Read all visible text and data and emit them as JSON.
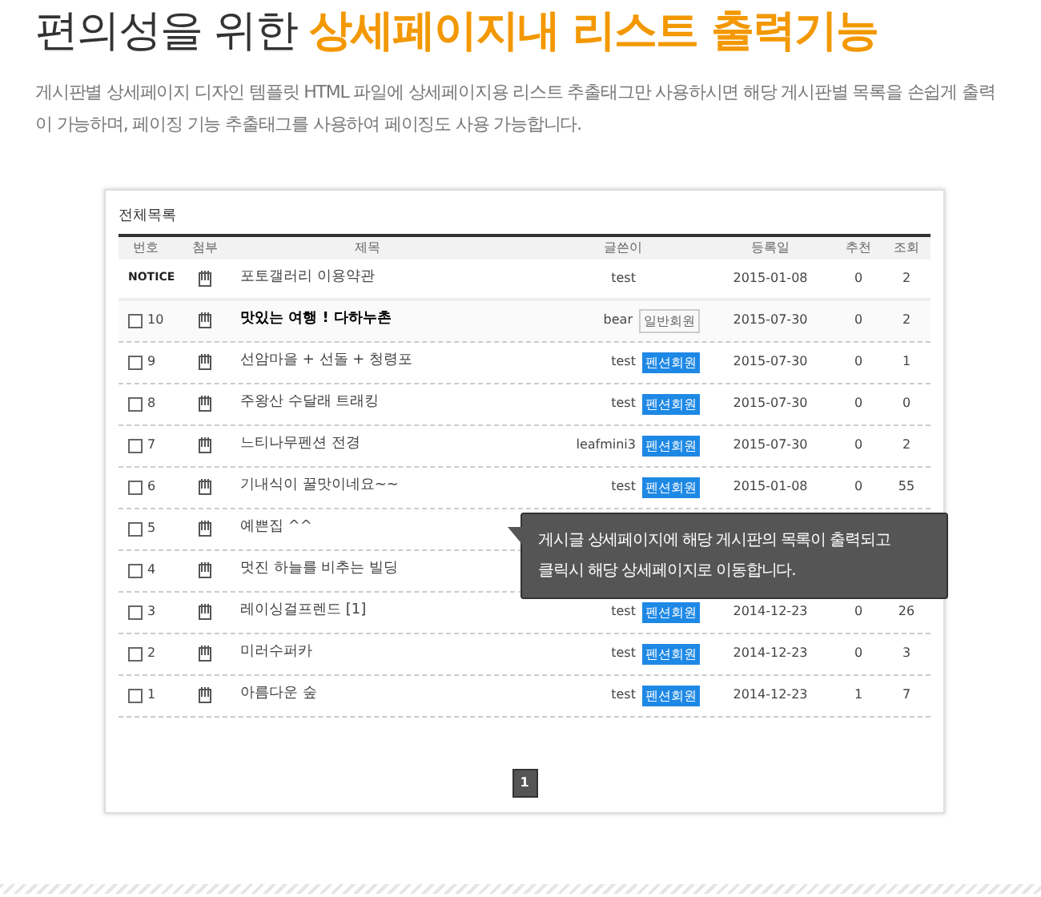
{
  "heading": {
    "plain": "편의성을 위한",
    "highlight": "상세페이지내 리스트 출력기능"
  },
  "description": "게시판별 상세페이지 디자인 템플릿 HTML 파일에 상세페이지용 리스트 추출태그만 사용하시면 해당 게시판별 목록을 손쉽게 출력이 가능하며, 페이징 기능 추출태그를 사용하여 페이징도 사용 가능합니다.",
  "board": {
    "title": "전체목록",
    "columns": [
      "번호",
      "첨부",
      "제목",
      "글쓴이",
      "등록일",
      "추천",
      "조회"
    ],
    "rows": [
      {
        "kind": "notice",
        "number": "NOTICE",
        "subject": "포토갤러리 이용약관",
        "writer": "test",
        "date": "2015-01-08",
        "recommend": "0",
        "views": "2"
      },
      {
        "kind": "post",
        "checked": false,
        "number": "10",
        "subject": "맛있는 여행 ! 다하누촌",
        "bold": true,
        "writer": "bear",
        "badge": {
          "kind": "general",
          "label": "일반회원"
        },
        "date": "2015-07-30",
        "recommend": "0",
        "views": "2"
      },
      {
        "kind": "post",
        "checked": false,
        "number": "9",
        "subject": "선암마을 + 선돌 + 청령포",
        "bold": false,
        "writer": "test",
        "badge": {
          "kind": "pension",
          "label": "펜션회원"
        },
        "date": "2015-07-30",
        "recommend": "0",
        "views": "1"
      },
      {
        "kind": "post",
        "checked": false,
        "number": "8",
        "subject": "주왕산 수달래 트래킹",
        "bold": false,
        "writer": "test",
        "badge": {
          "kind": "pension",
          "label": "펜션회원"
        },
        "date": "2015-07-30",
        "recommend": "0",
        "views": "0"
      },
      {
        "kind": "post",
        "checked": false,
        "number": "7",
        "subject": "느티나무펜션 전경",
        "bold": false,
        "writer": "leafmini3",
        "badge": {
          "kind": "pension",
          "label": "펜션회원"
        },
        "date": "2015-07-30",
        "recommend": "0",
        "views": "2"
      },
      {
        "kind": "post",
        "checked": false,
        "number": "6",
        "subject": "기내식이 꿀맛이네요~~",
        "bold": false,
        "writer": "test",
        "badge": {
          "kind": "pension",
          "label": "펜션회원"
        },
        "date": "2015-01-08",
        "recommend": "0",
        "views": "55"
      },
      {
        "kind": "post",
        "checked": false,
        "number": "5",
        "subject": "예쁜집 ^^",
        "bold": false
      },
      {
        "kind": "post",
        "checked": false,
        "number": "4",
        "subject": "멋진 하늘를 비추는 빌딩",
        "bold": false
      },
      {
        "kind": "post",
        "checked": false,
        "number": "3",
        "subject": "레이싱걸프렌드 [1]",
        "bold": false,
        "writer": "test",
        "badge": {
          "kind": "pension",
          "label": "펜션회원"
        },
        "date": "2014-12-23",
        "recommend": "0",
        "views": "26"
      },
      {
        "kind": "post",
        "checked": false,
        "number": "2",
        "subject": "미러수퍼카",
        "bold": false,
        "writer": "test",
        "badge": {
          "kind": "pension",
          "label": "펜션회원"
        },
        "date": "2014-12-23",
        "recommend": "0",
        "views": "3"
      },
      {
        "kind": "post",
        "checked": false,
        "number": "1",
        "subject": "아름다운 숲",
        "bold": false,
        "writer": "test",
        "badge": {
          "kind": "pension",
          "label": "펜션회원"
        },
        "date": "2014-12-23",
        "recommend": "1",
        "views": "7"
      }
    ],
    "pages": [
      {
        "label": "1",
        "selected": true
      }
    ]
  },
  "tooltip": {
    "lines": [
      "게시글 상세페이지에 해당 게시판의 목록이 출력되고",
      "클릭시 해당 상세페이지로 이동합니다."
    ]
  }
}
